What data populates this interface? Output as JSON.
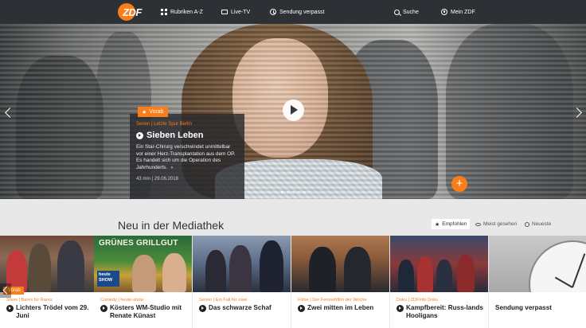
{
  "nav": {
    "logo": "ZDF",
    "items": [
      {
        "label": "Rubriken A-Z",
        "icon": "grid-icon"
      },
      {
        "label": "Live-TV",
        "icon": "tv-icon"
      },
      {
        "label": "Sendung verpasst",
        "icon": "clock-icon"
      },
      {
        "label": "Suche",
        "icon": "search-icon"
      },
      {
        "label": "Mein ZDF",
        "icon": "user-icon"
      }
    ]
  },
  "hero": {
    "badge": "Vorab",
    "category": "Serien | Letzte Spur Berlin",
    "title": "Sieben Leben",
    "description": "Ein Star-Chirurg verschwindet unmittelbar vor einer Herz-Transplantation aus dem OP. Es handelt sich um die Operation des Jahrhunderts.",
    "more": "...",
    "meta": "43 min | 29.06.2018",
    "accent_color": "#fa7d19"
  },
  "section": {
    "title": "Neu in der Mediathek",
    "filters": [
      "Empfohlen",
      "Meist gesehen",
      "Neueste"
    ],
    "active_filter": "Empfohlen"
  },
  "cards": [
    {
      "category": "Show | Bares für Rares",
      "title": "Lichters Trödel vom 29. Juni",
      "tag": "Vorab"
    },
    {
      "category": "Comedy | heute-show",
      "title": "Kösters WM-Studio mit Renate Künast",
      "thumb_text": "GRÜNES GRILLGUT",
      "logo_text": "heute SHOW"
    },
    {
      "category": "Serien | Ein Fall für zwei",
      "title": "Das schwarze Schaf"
    },
    {
      "category": "Filme | Der Fernsehfilm der Woche",
      "title": "Zwei mitten im Leben"
    },
    {
      "category": "Doku | ZDFinfo Doku",
      "title": "Kampfbereit: Russ-lands Hooligans"
    },
    {
      "title": "Sendung verpasst"
    }
  ]
}
